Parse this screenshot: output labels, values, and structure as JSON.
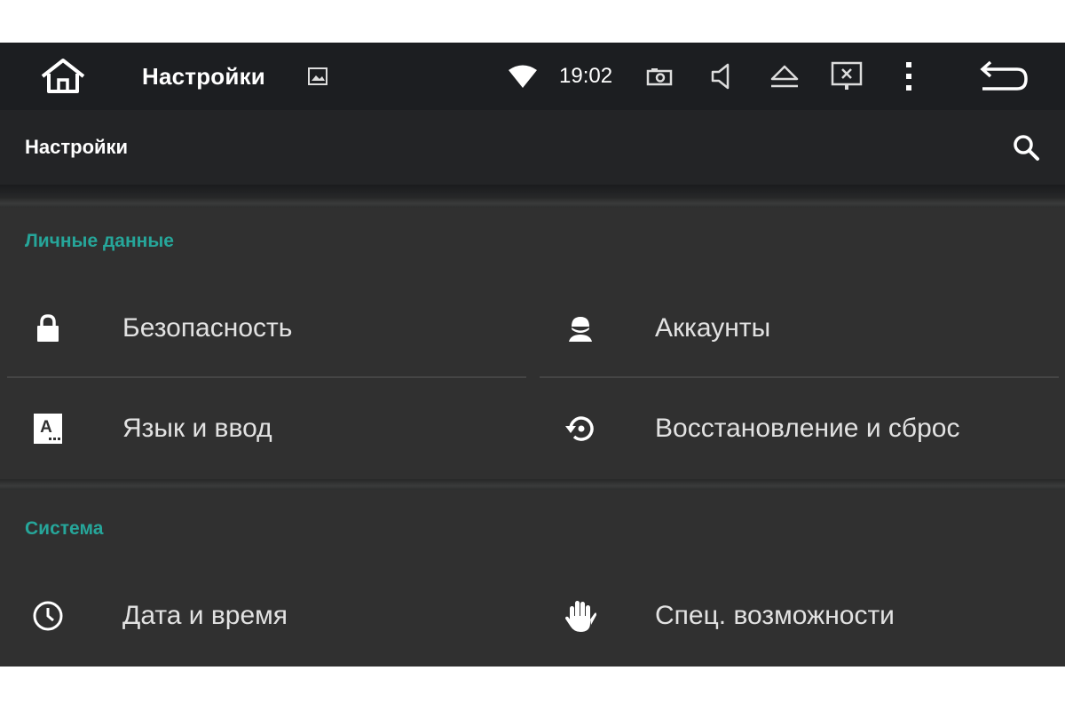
{
  "status_bar": {
    "title": "Настройки",
    "time": "19:02",
    "icons": [
      "home-icon",
      "image-icon",
      "wifi-icon",
      "camera-icon",
      "speaker-icon",
      "eject-icon",
      "screen-off-icon",
      "more-vert-icon",
      "back-icon"
    ]
  },
  "action_bar": {
    "title": "Настройки",
    "search_icon": "search-icon"
  },
  "sections": [
    {
      "header": "Личные данные",
      "items": [
        {
          "label": "Безопасность",
          "icon": "lock-icon"
        },
        {
          "label": "Аккаунты",
          "icon": "account-icon"
        },
        {
          "label": "Язык и ввод",
          "icon": "language-icon"
        },
        {
          "label": "Восстановление и сброс",
          "icon": "restore-icon"
        }
      ]
    },
    {
      "header": "Система",
      "items": [
        {
          "label": "Дата и время",
          "icon": "clock-icon"
        },
        {
          "label": "Спец. возможности",
          "icon": "accessibility-hand-icon"
        }
      ]
    }
  ],
  "colors": {
    "status_bar_bg": "#1c1e21",
    "action_bar_bg": "#232426",
    "list_bg": "#303030",
    "accent": "#26a69a",
    "text": "#e2e2e2"
  }
}
